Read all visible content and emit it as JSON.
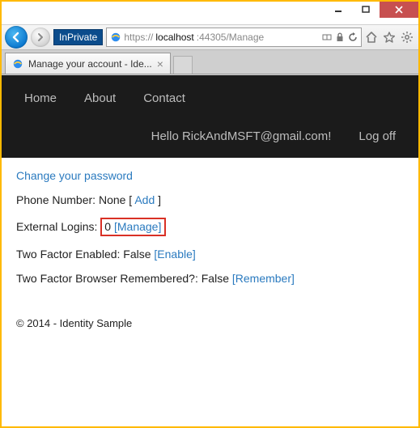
{
  "titlebar": {
    "min": "",
    "max": "",
    "close": ""
  },
  "nav": {
    "inprivate_label": "InPrivate",
    "url_scheme": "https://",
    "url_host": "localhost",
    "url_rest": ":44305/Manage"
  },
  "tab": {
    "title": "Manage your account - Ide..."
  },
  "header": {
    "links": [
      "Home",
      "About",
      "Contact"
    ],
    "greeting": "Hello RickAndMSFT@gmail.com!",
    "logoff": "Log off"
  },
  "body": {
    "change_pw": "Change your password",
    "phone_label": "Phone Number:",
    "phone_value": "None",
    "phone_add": "Add",
    "ext_label": "External Logins:",
    "ext_count": "0",
    "ext_manage": "[Manage]",
    "tfe_label": "Two Factor Enabled:",
    "tfe_value": "False",
    "tfe_action": "[Enable]",
    "tfbr_label": "Two Factor Browser Remembered?:",
    "tfbr_value": "False",
    "tfbr_action": "[Remember]"
  },
  "footer": {
    "text": "© 2014 - Identity Sample"
  }
}
